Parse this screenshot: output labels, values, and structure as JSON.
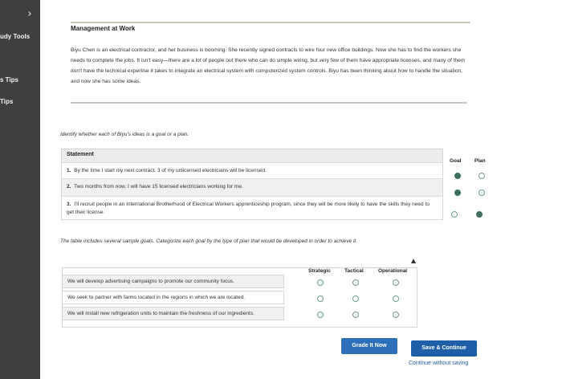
{
  "sidebar": {
    "items": [
      {
        "label": "udy Tools"
      },
      {
        "label": "s Tips"
      },
      {
        "label": "Tips"
      }
    ]
  },
  "article": {
    "title": "Management at Work",
    "body": "Biyu Chen is an electrical contractor, and her business is booming. She recently signed contracts to wire four new office buildings. Now she has to find the workers she needs to complete the jobs. It isn't easy—there are a lot of people out there who can do simple wiring, but very few of them have appropriate licenses, and many of them don't have the technical expertise it takes to integrate an electrical system with computerized system controls. Biyu has been thinking about how to handle the situation, and now she has some ideas."
  },
  "question1": {
    "prompt": "Identify whether each of Biyu's ideas is a goal or a plan.",
    "statement_header": "Statement",
    "col_goal": "Goal",
    "col_plan": "Plan",
    "rows": [
      {
        "num": "1.",
        "text": "By the time I start my next contract, 3 of my unlicensed electricians will be licensed.",
        "selected": "Goal"
      },
      {
        "num": "2.",
        "text": "Two months from now, I will have 15 licensed electricians working for me.",
        "selected": "Goal"
      },
      {
        "num": "3.",
        "text": "I'll recruit people in an International Brotherhood of Electrical Workers apprenticeship program, since they will be more likely to have the skills they need to get their license.",
        "selected": "Plan"
      }
    ]
  },
  "question2": {
    "prompt": "The table includes several sample goals. Categorize each goal by the type of plan that would be developed in order to achieve it.",
    "col_strategic": "Strategic",
    "col_tactical": "Tactical",
    "col_operational": "Operational",
    "rows": [
      {
        "text": "We will develop advertising campaigns to promote our community focus."
      },
      {
        "text": "We seek to partner with farms located in the regions in which we are located."
      },
      {
        "text": "We will install new refrigeration units to maintain the freshness of our ingredients."
      }
    ]
  },
  "actions": {
    "grade_label": "Grade It Now",
    "save_label": "Save & Continue",
    "continue_label": "Continue without saving"
  },
  "colors": {
    "sidebar_bg": "#3f3f3f",
    "accent": "#1f5fa8",
    "radio_selected": "#3e6f5d"
  }
}
